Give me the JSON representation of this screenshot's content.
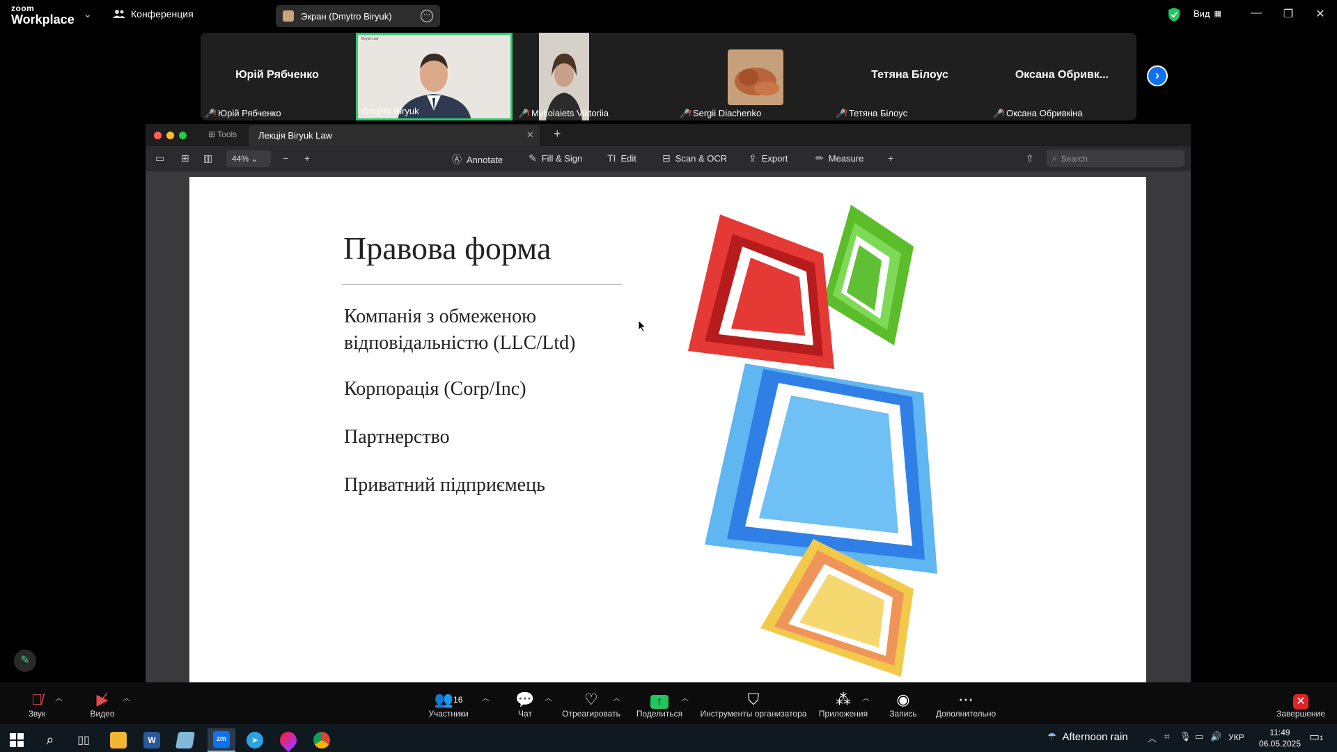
{
  "app": {
    "logo_top": "zoom",
    "logo_bottom": "Workplace",
    "meeting_label": "Конференция",
    "screen_share_label": "Экран (Dmytro Biryuk)",
    "view_label": "Вид"
  },
  "gallery": {
    "tiles": [
      {
        "big": "Юрій Рябченко",
        "label": "Юрій Рябченко"
      },
      {
        "big": "",
        "label": "Dmytro Biryuk"
      },
      {
        "big": "",
        "label": "Mykolaiets Viktoriia"
      },
      {
        "big": "",
        "label": "Sergii Diachenko"
      },
      {
        "big": "Тетяна Білоус",
        "label": "Тетяна Білоус"
      },
      {
        "big": "Оксана  Обривк...",
        "label": "Оксана Обривкіна"
      }
    ],
    "thumb_caption": "Biryuk Law"
  },
  "preview": {
    "tab_tools": "Tools",
    "tab_title": "Лекція Biryuk Law",
    "zoom": "44%",
    "toolbar": {
      "annotate": "Annotate",
      "fill_sign": "Fill & Sign",
      "edit": "Edit",
      "scan_ocr": "Scan & OCR",
      "export": "Export",
      "measure": "Measure"
    },
    "search_placeholder": "Search"
  },
  "slide": {
    "title": "Правова форма",
    "items": [
      "Компанія з обмеженою відповідальністю (LLC/Ltd)",
      "Корпорація (Corp/Inc)",
      "Партнерство",
      "Приватний підприємець"
    ],
    "colors": {
      "red": "#e53935",
      "green": "#5bbd2a",
      "blue": "#3d8ef0",
      "yellow": "#f3c94b"
    }
  },
  "controls": {
    "audio": "Звук",
    "video": "Видео",
    "participants": "Участники",
    "participants_count": "16",
    "chat": "Чат",
    "react": "Отреагировать",
    "share": "Поделиться",
    "host_tools": "Инструменты организатора",
    "apps": "Приложения",
    "record": "Запись",
    "more": "Дополнительно",
    "end": "Завершение"
  },
  "taskbar": {
    "weather": "Afternoon rain",
    "lang": "УКР",
    "time": "11:49",
    "date": "06.05.2025",
    "notifications": "1"
  }
}
